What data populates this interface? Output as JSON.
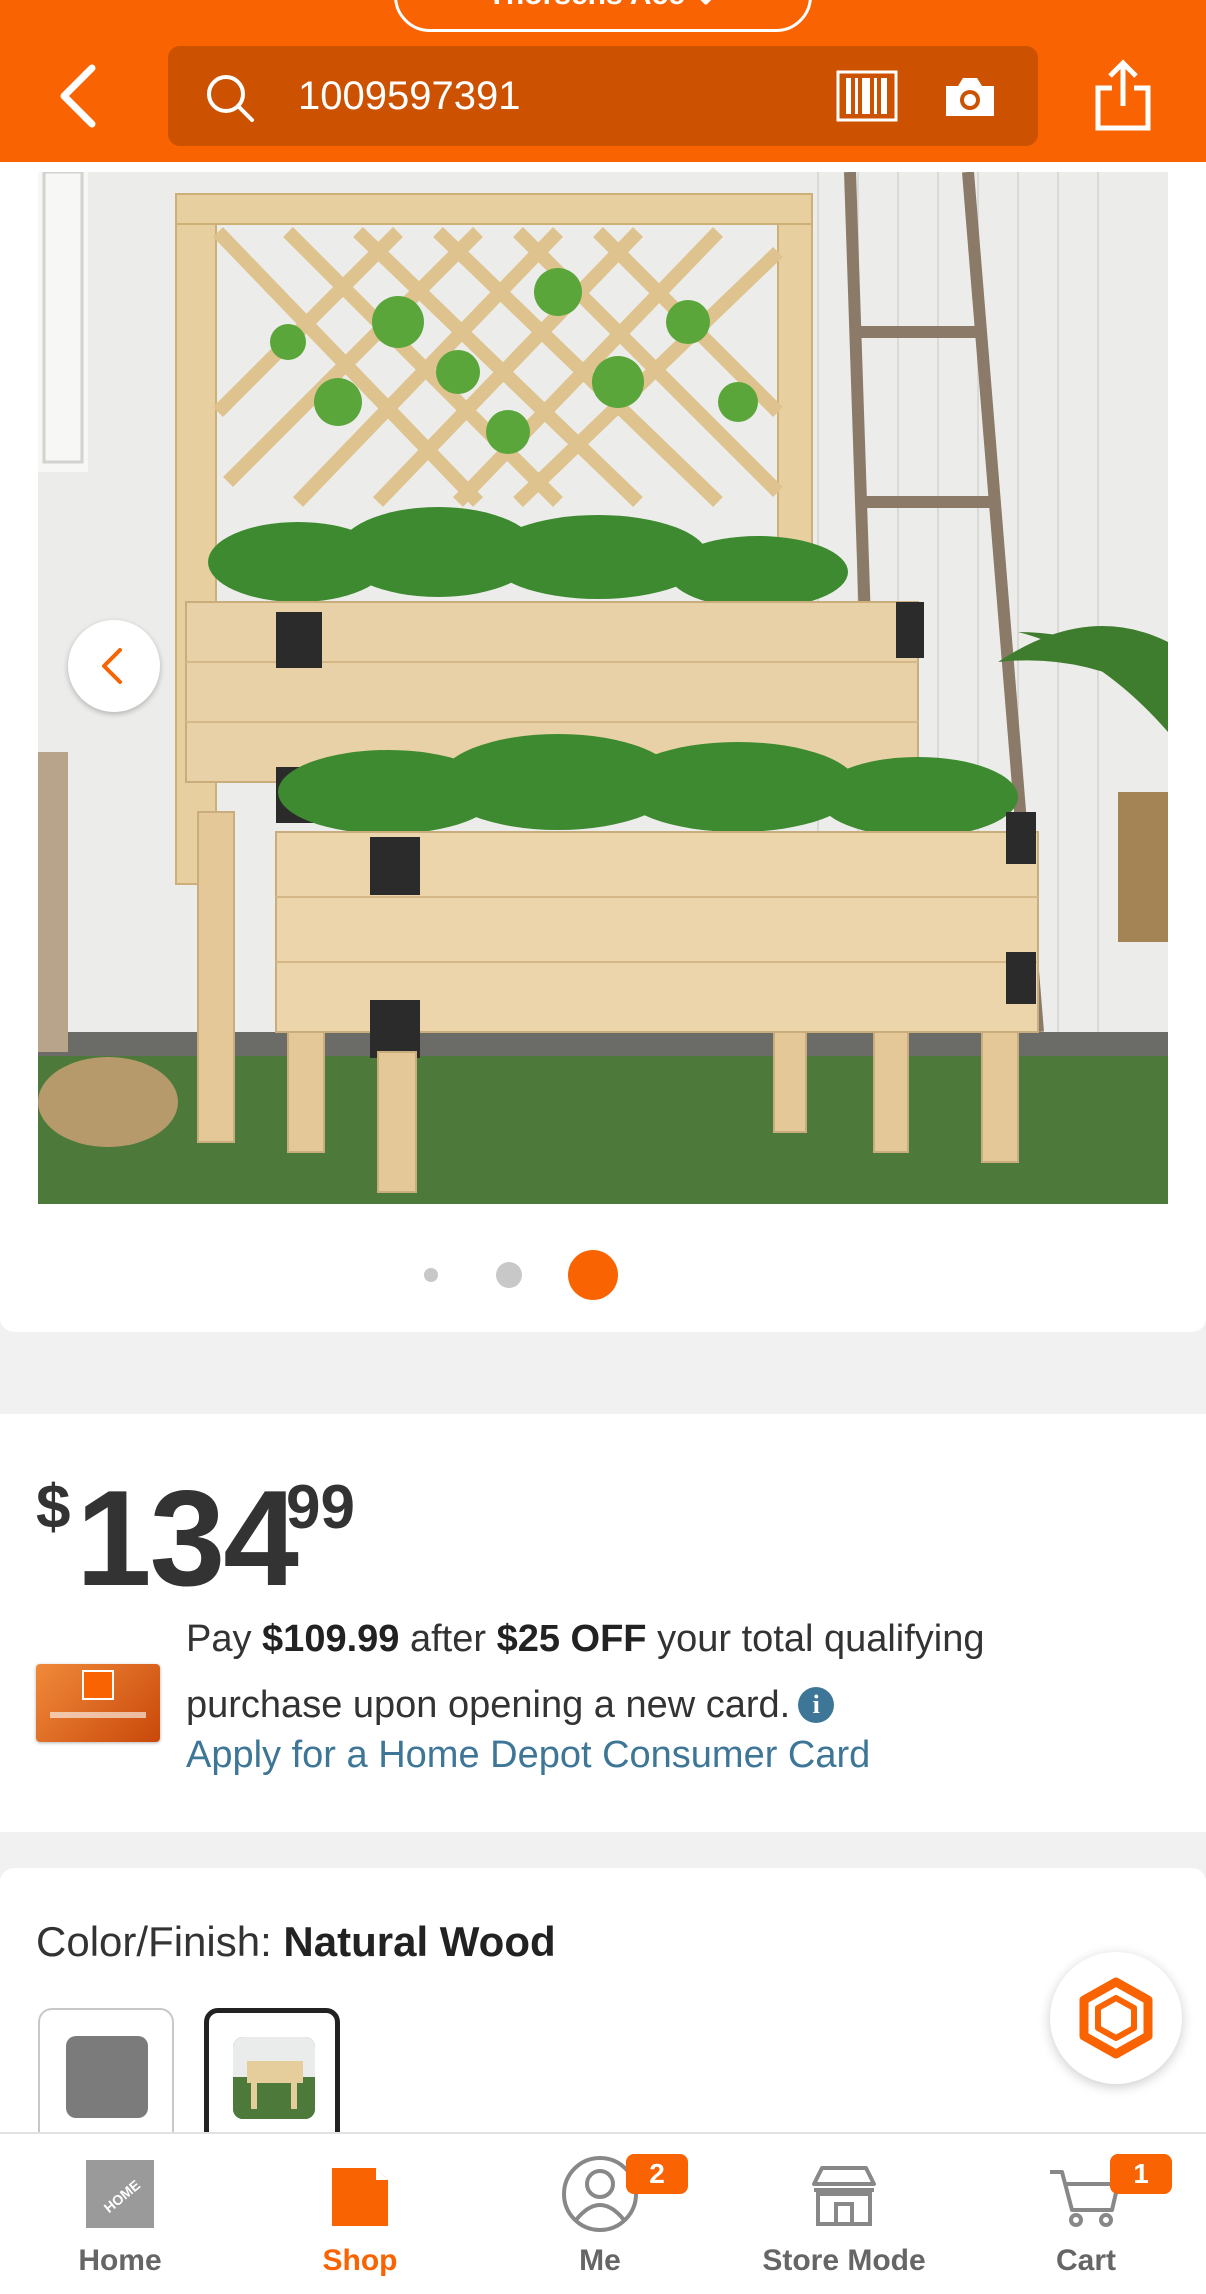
{
  "header": {
    "store_label": "Thorsens Ace",
    "search_value": "1009597391"
  },
  "gallery": {
    "image_alt": "Natural wood two-tier elevated planter box with lattice trellis and green plants",
    "slide_count": 3,
    "active_slide": 3
  },
  "price": {
    "currency": "$",
    "whole": "134",
    "cents": "99"
  },
  "promo": {
    "text_pay": "Pay ",
    "discounted_price": "$109.99",
    "text_after": " after ",
    "discount": "$25 OFF",
    "text_rest": " your total qualifying purchase upon opening a new card.",
    "apply_link": "Apply for a Home Depot Consumer Card"
  },
  "color": {
    "label": "Color/Finish: ",
    "value": "Natural Wood",
    "swatches": [
      "Gray",
      "Natural Wood"
    ],
    "selected_index": 1
  },
  "nav": {
    "items": [
      {
        "label": "Home",
        "icon": "home-depot-logo-icon"
      },
      {
        "label": "Shop",
        "icon": "shop-icon"
      },
      {
        "label": "Me",
        "icon": "user-icon",
        "badge": "2"
      },
      {
        "label": "Store Mode",
        "icon": "store-icon"
      },
      {
        "label": "Cart",
        "icon": "cart-icon",
        "badge": "1"
      }
    ],
    "active": "Shop"
  },
  "colors": {
    "brand_orange": "#f96302",
    "link_blue": "#3e7697"
  }
}
